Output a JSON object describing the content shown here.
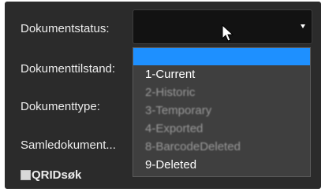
{
  "form": {
    "labels": {
      "dokumentstatus": "Dokumentstatus:",
      "dokumenttilstand": "Dokumenttilstand:",
      "dokumenttype": "Dokumenttype:",
      "samledokument": "Samledokument..."
    },
    "qrid_label": "QRIDsøk"
  },
  "select": {
    "value": ""
  },
  "dropdown": {
    "options": [
      {
        "label": "",
        "state": "highlighted"
      },
      {
        "label": "1-Current",
        "state": "enabled"
      },
      {
        "label": "2-Historic",
        "state": "disabled"
      },
      {
        "label": "3-Temporary",
        "state": "disabled"
      },
      {
        "label": "4-Exported",
        "state": "disabled"
      },
      {
        "label": "8-BarcodeDeleted",
        "state": "disabled"
      },
      {
        "label": "9-Deleted",
        "state": "enabled"
      }
    ]
  },
  "colors": {
    "panel_background": "#2b2b2b",
    "highlight": "#1e90ff",
    "select_background": "#121212",
    "dropdown_background": "#3f3f3f"
  },
  "icons": {
    "checkbox": "checkbox-icon",
    "arrow": "chevron-down-icon",
    "cursor": "mouse-cursor-icon"
  }
}
